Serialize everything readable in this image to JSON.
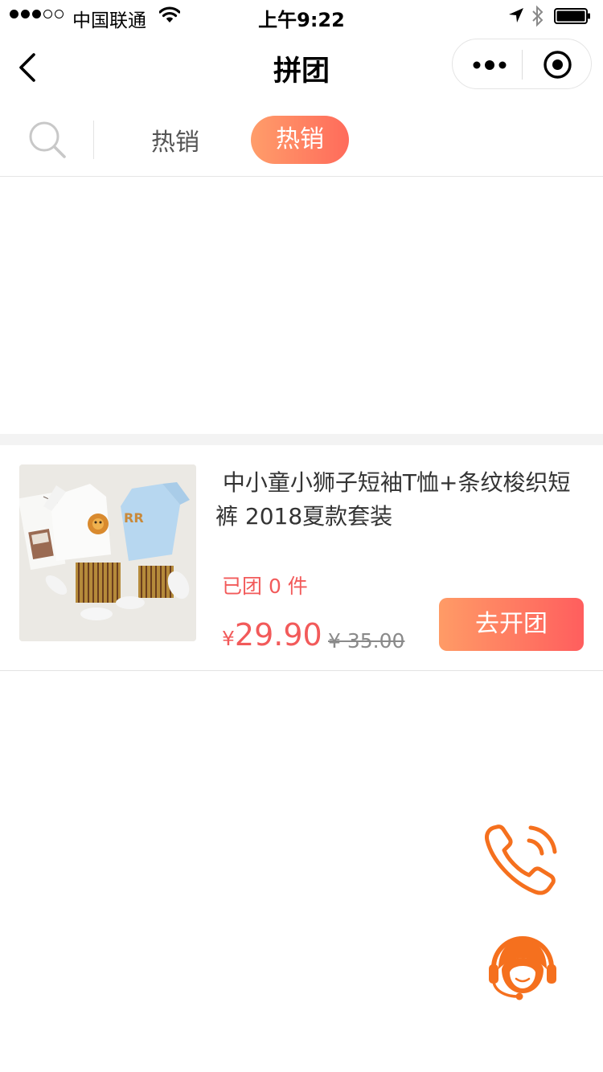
{
  "status_bar": {
    "carrier": "中国联通",
    "time": "上午9:22",
    "signal_filled": 3,
    "signal_total": 5,
    "battery_level": 1.0,
    "icons": [
      "signal-icon",
      "wifi-icon",
      "location-arrow-icon",
      "bluetooth-icon",
      "battery-icon"
    ]
  },
  "nav": {
    "title": "拼团",
    "back_icon": "chevron-left-icon",
    "capsule_icons": [
      "more-dots-icon",
      "close-target-icon"
    ]
  },
  "tabs": {
    "search_icon": "search-icon",
    "items": [
      {
        "label": "热销",
        "active": false
      },
      {
        "label": "热销",
        "active": true
      }
    ]
  },
  "product": {
    "title": " 中小童小狮子短袖T恤+条纹梭织短裤 2018夏款套装",
    "grouped_text": "已团 0 件",
    "price_symbol": "¥",
    "price": "29.90",
    "original_price": "¥ 35.00",
    "button_label": "去开团"
  },
  "floating": {
    "icons": [
      "phone-icon",
      "customer-service-icon"
    ]
  },
  "colors": {
    "accent_gradient_start": "#ff9d6a",
    "accent_gradient_end": "#ff5e5e",
    "price_red": "#f25a5a",
    "float_orange": "#f5701e"
  }
}
